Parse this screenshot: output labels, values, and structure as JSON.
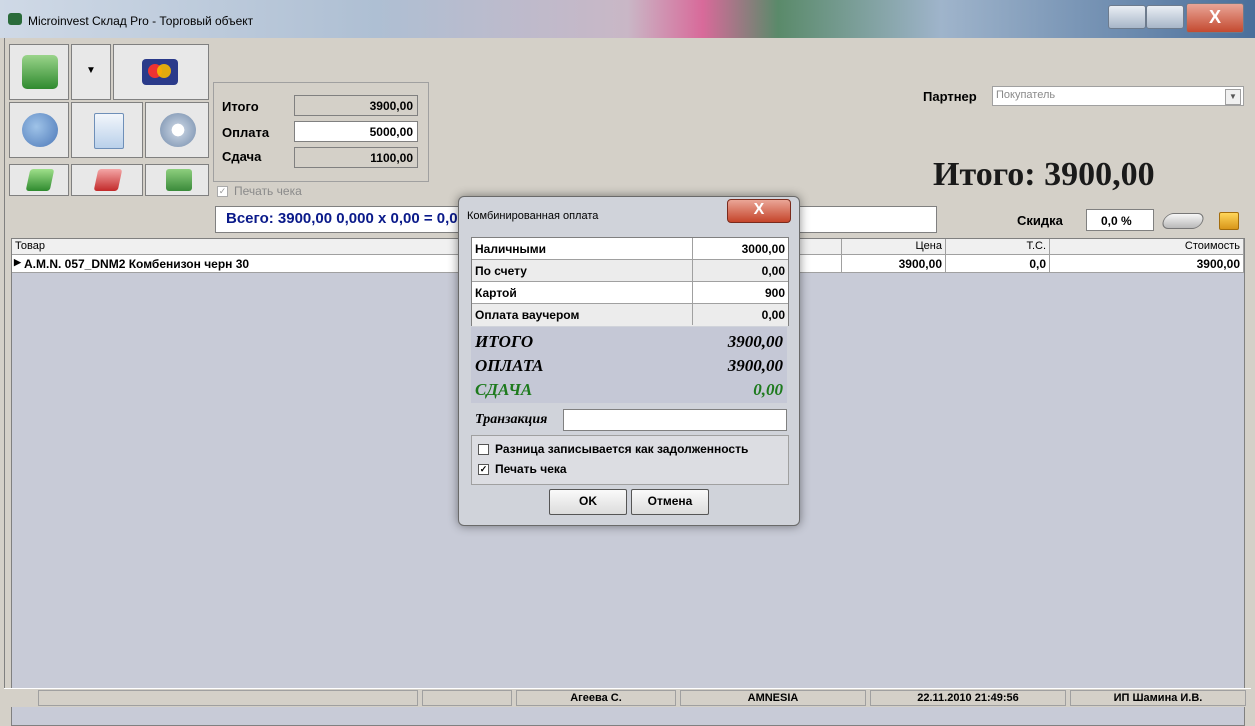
{
  "window": {
    "title": "Microinvest Склад Pro - Торговый объект",
    "close_label": "X"
  },
  "summary": {
    "itogo_label": "Итого",
    "itogo_value": "3900,00",
    "oplata_label": "Оплата",
    "oplata_value": "5000,00",
    "sdacha_label": "Сдача",
    "sdacha_value": "1100,00",
    "print_check": "Печать чека"
  },
  "formula": "Всего: 3900,00    0,000  x  0,00  =  0,00",
  "partner": {
    "label": "Партнер",
    "value": "Покупатель"
  },
  "big_total": "Итого:  3900,00",
  "discount": {
    "label": "Скидка",
    "value": "0,0 %"
  },
  "grid": {
    "columns": [
      "Товар",
      "Цена",
      "Т.С.",
      "Стоимость"
    ],
    "rows": [
      {
        "product": "A.M.N. 057_DNM2 Комбенизон черн 30",
        "price": "3900,00",
        "ts": "0,0",
        "cost": "3900,00"
      }
    ]
  },
  "status": {
    "user": "Агеева С.",
    "object": "AMNESIA",
    "datetime": "22.11.2010 21:49:56",
    "company": "ИП Шамина И.В."
  },
  "dialog": {
    "title": "Комбинированная оплата",
    "close_label": "X",
    "payments": [
      {
        "label": "Наличными",
        "value": "3000,00"
      },
      {
        "label": "По счету",
        "value": "0,00"
      },
      {
        "label": "Картой",
        "value": "900"
      },
      {
        "label": "Оплата ваучером",
        "value": "0,00"
      }
    ],
    "totals": [
      {
        "label": "ИТОГО",
        "value": "3900,00"
      },
      {
        "label": "ОПЛАТА",
        "value": "3900,00"
      },
      {
        "label": "СДАЧА",
        "value": "0,00"
      }
    ],
    "transaction_label": "Транзакция",
    "transaction_value": "",
    "option_debt": "Разница записывается как задолженность",
    "option_print": "Печать чека",
    "ok_label": "OK",
    "cancel_label": "Отмена"
  },
  "colors": {
    "change_green": "#1d7a1d",
    "formula_blue": "#0a1a8a"
  }
}
